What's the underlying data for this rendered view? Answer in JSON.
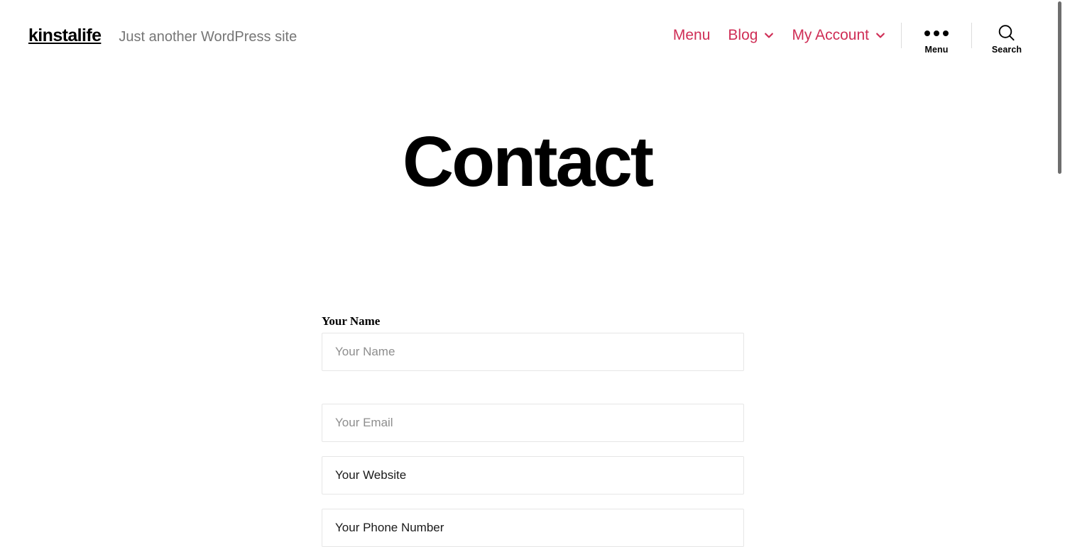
{
  "header": {
    "site_title": "kinstalife",
    "site_description": "Just another WordPress site",
    "nav_items": [
      {
        "label": "Menu",
        "has_chevron": false
      },
      {
        "label": "Blog",
        "has_chevron": true
      },
      {
        "label": "My Account",
        "has_chevron": true
      }
    ],
    "menu_toggle": {
      "icon": "three-dots-icon",
      "label": "Menu"
    },
    "search_toggle": {
      "icon": "search-icon",
      "label": "Search"
    }
  },
  "main": {
    "page_title": "Contact"
  },
  "form": {
    "fields": [
      {
        "label": "Your Name",
        "placeholder": "Your Name",
        "value": "",
        "name": "your-name"
      },
      {
        "label": "",
        "placeholder": "Your Email",
        "value": "",
        "name": "your-email"
      },
      {
        "label": "",
        "placeholder": "Your Website",
        "value": "Your Website",
        "name": "your-website"
      },
      {
        "label": "",
        "placeholder": "Your Phone Number",
        "value": "Your Phone Number",
        "name": "your-phone-number"
      }
    ]
  },
  "colors": {
    "accent": "#cf2e56",
    "text": "#000000",
    "muted": "#767676",
    "placeholder": "#8e8e8e",
    "border": "#e6e6e6",
    "divider": "#dcdcdc",
    "scrollbar": "#6e6e6e"
  }
}
